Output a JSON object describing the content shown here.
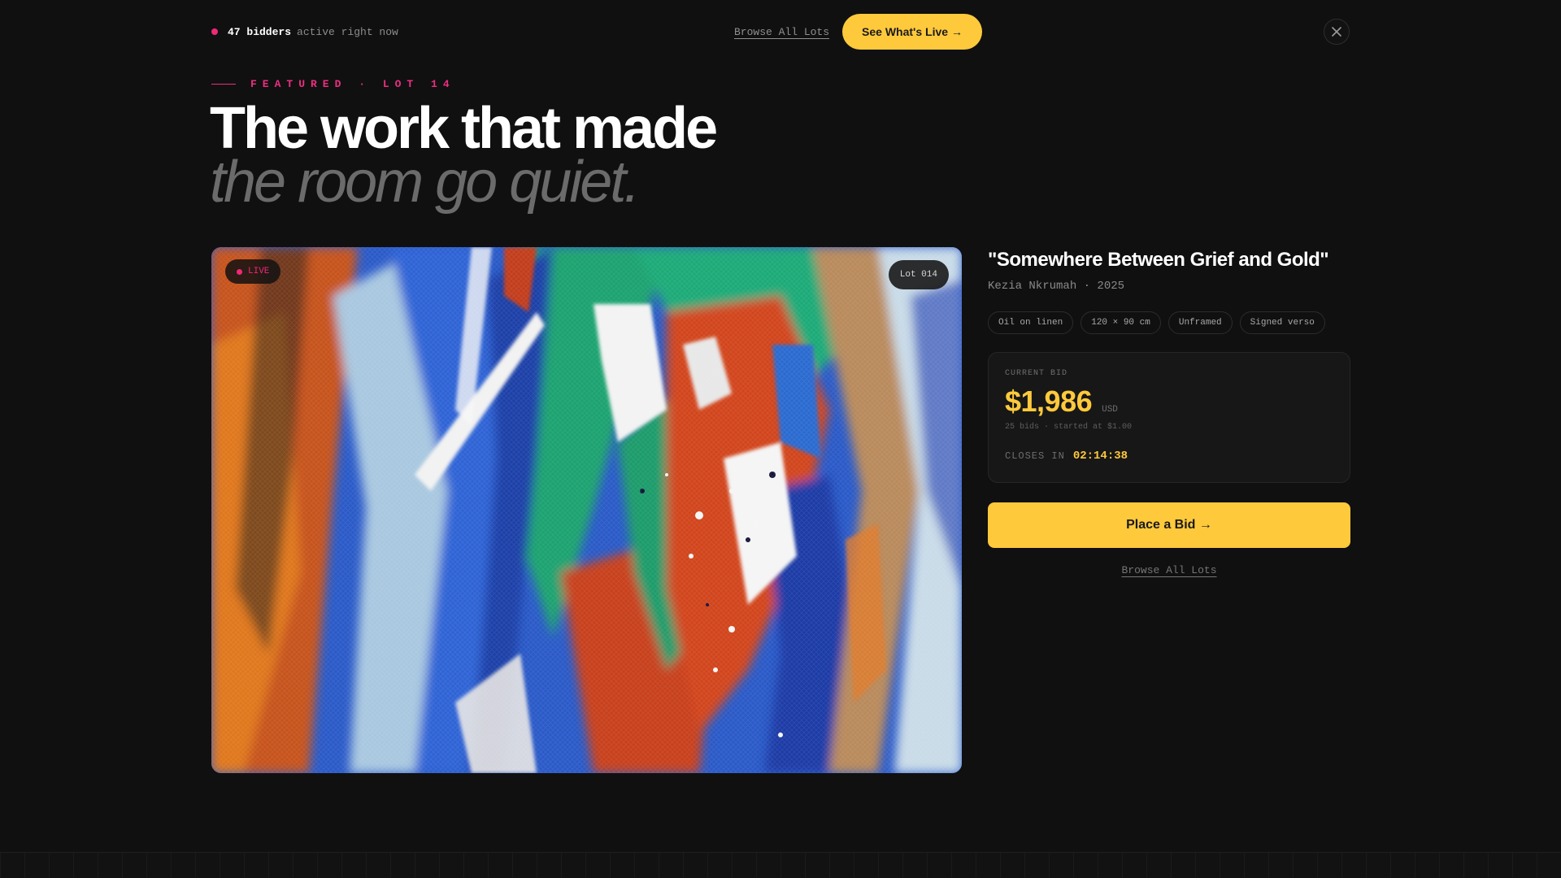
{
  "topbar": {
    "bidders_count": "47 bidders",
    "bidders_suffix": "active right now",
    "browse_link": "Browse All Lots",
    "cta_label": "See What's Live →"
  },
  "hero": {
    "eyebrow": "FEATURED · LOT 14",
    "headline_line1": "The work that made",
    "headline_line2": "the room go quiet."
  },
  "artwork": {
    "live_badge": "LIVE",
    "lot_badge": "Lot 014",
    "title": "\"Somewhere Between Grief and Gold\"",
    "artist_line": "Kezia Nkrumah · 2025",
    "tags": [
      "Oil on linen",
      "120 × 90 cm",
      "Unframed",
      "Signed verso"
    ]
  },
  "bid": {
    "label": "CURRENT BID",
    "amount": "$1,986",
    "currency": "USD",
    "meta": "25 bids · started at $1.00",
    "closes_label": "CLOSES IN",
    "closes_time": "02:14:38",
    "place_bid_label": "Place a Bid →",
    "browse_link": "Browse All Lots"
  },
  "colors": {
    "accent_yellow": "#ffc93c",
    "accent_pink": "#ec2e80",
    "background": "#101010"
  }
}
